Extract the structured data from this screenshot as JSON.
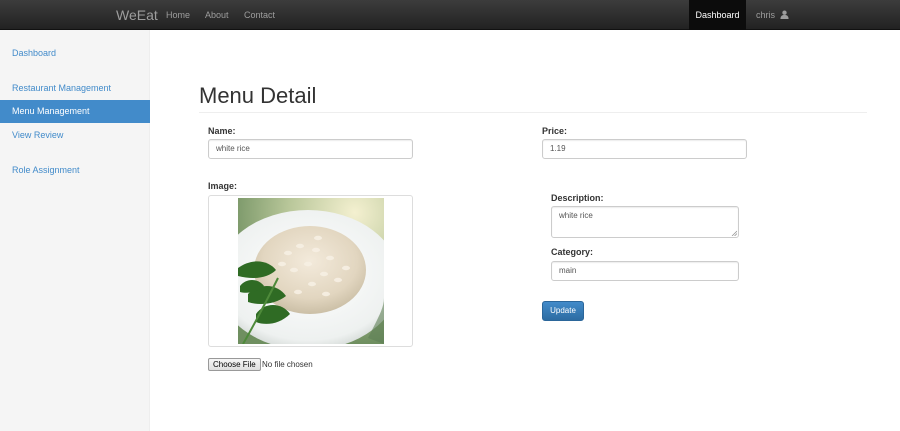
{
  "navbar": {
    "brand": "WeEat",
    "links": [
      "Home",
      "About",
      "Contact"
    ],
    "active_item": "Dashboard",
    "user": "chris",
    "user_icon": "user-icon"
  },
  "sidebar": {
    "items": [
      {
        "label": "Dashboard",
        "active": false
      },
      {
        "label": "Restaurant Management",
        "active": false
      },
      {
        "label": "Menu Management",
        "active": true
      },
      {
        "label": "View Review",
        "active": false
      },
      {
        "label": "Role Assignment",
        "active": false
      }
    ]
  },
  "main": {
    "title": "Menu Detail",
    "form": {
      "name_label": "Name:",
      "name_value": "white rice",
      "price_label": "Price:",
      "price_value": "1.19",
      "image_label": "Image:",
      "choose_file_label": "Choose File",
      "file_status": "No file chosen",
      "description_label": "Description:",
      "description_value": "white rice",
      "category_label": "Category:",
      "category_value": "main",
      "update_label": "Update"
    }
  },
  "colors": {
    "navbar_bg": "#222222",
    "accent": "#428bca",
    "sidebar_bg": "#f5f5f5"
  }
}
